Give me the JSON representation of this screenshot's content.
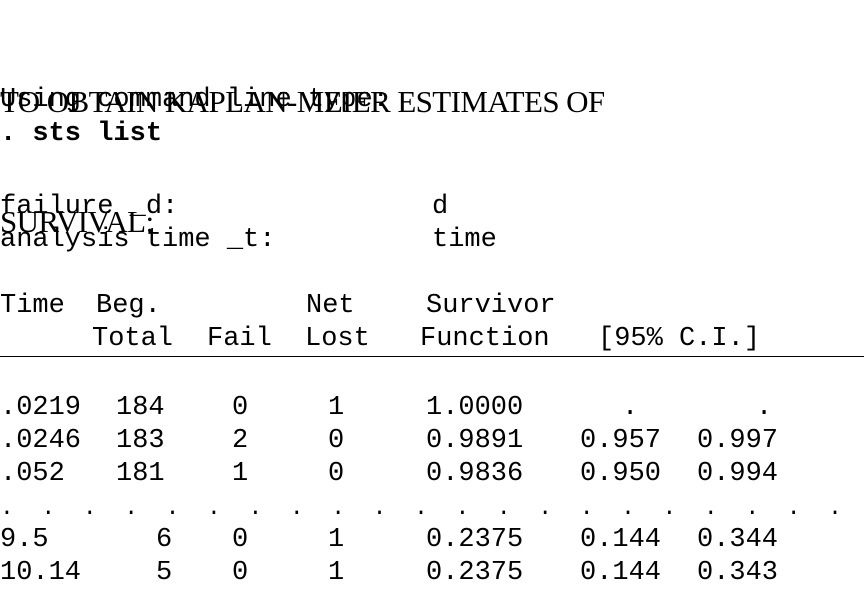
{
  "title": {
    "line1": "TO OBTAIN KAPLAN-MEIER ESTIMATES OF",
    "line2": "SURVIVAL:"
  },
  "instruction": "Using command line type:",
  "command": ". sts list",
  "info": {
    "failure_label": "failure _d:",
    "failure_value": "d",
    "analysis_label": "analysis time _t:",
    "analysis_value": "time"
  },
  "table": {
    "header_row1": {
      "time": "Time",
      "beg": "Beg.",
      "net": "Net",
      "survivor": "Survivor"
    },
    "header_row2": {
      "total": "Total",
      "fail": "Fail",
      "lost": "Lost",
      "function": "Function",
      "ci": "[95% C.I.]"
    },
    "rows": [
      {
        "time": ".0219",
        "total": "184",
        "fail": "0",
        "lost": "1",
        "survivor": "1.0000",
        "ci_low": ".",
        "ci_high": "."
      },
      {
        "time": ".0246",
        "total": "183",
        "fail": "2",
        "lost": "0",
        "survivor": "0.9891",
        "ci_low": "0.957",
        "ci_high": "0.997"
      },
      {
        "time": ".052",
        "total": "181",
        "fail": "1",
        "lost": "0",
        "survivor": "0.9836",
        "ci_low": "0.950",
        "ci_high": "0.994"
      }
    ],
    "ellipsis": ".  .  .  .  .  .  .  .  .  .  .  .  .  .  .  .  .  .  .  .  .   .",
    "tail_rows": [
      {
        "time": "9.5",
        "total": "6",
        "fail": "0",
        "lost": "1",
        "survivor": "0.2375",
        "ci_low": "0.144",
        "ci_high": "0.344"
      },
      {
        "time": "10.14",
        "total": "5",
        "fail": "0",
        "lost": "1",
        "survivor": "0.2375",
        "ci_low": "0.144",
        "ci_high": "0.343"
      }
    ]
  }
}
